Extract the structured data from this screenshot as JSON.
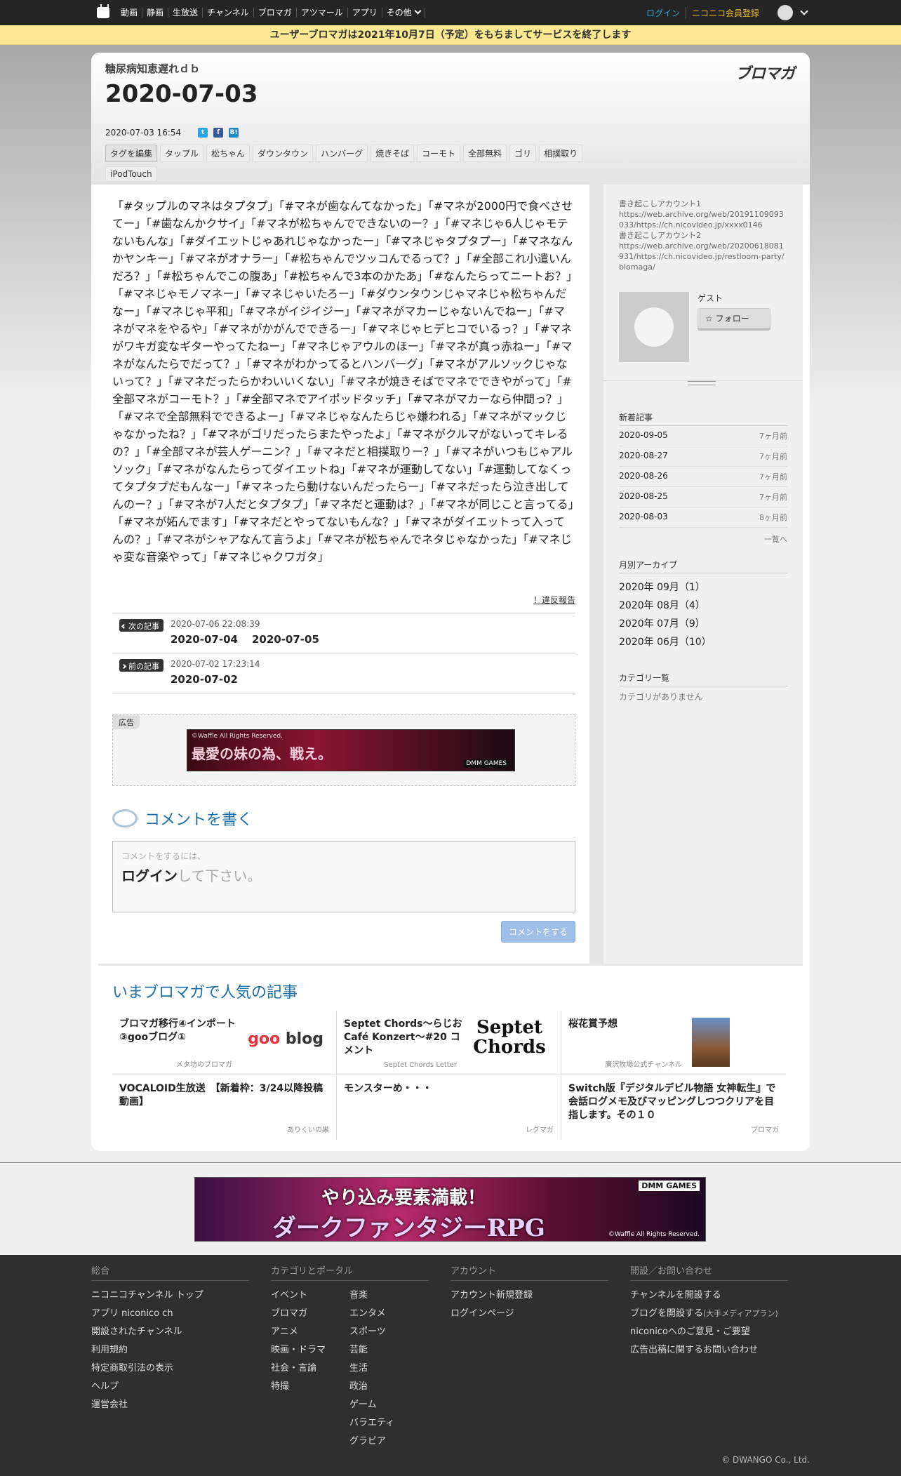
{
  "nav": {
    "items": [
      "動画",
      "静画",
      "生放送",
      "チャンネル",
      "ブロマガ",
      "アツマール",
      "アプリ",
      "その他"
    ],
    "login": "ログイン",
    "register": "ニコニコ会員登録"
  },
  "notice": "ユーザーブロマガは2021年10月7日（予定）をもちましてサービスを終了します",
  "header": {
    "channel": "糖尿病知恵遅れｄｂ",
    "title": "2020-07-03",
    "brand": "ブロマガ",
    "datetime": "2020-07-03 16:54",
    "tag_edit": "タグを編集",
    "tags": [
      "タップル",
      "松ちゃん",
      "ダウンタウン",
      "ハンバーグ",
      "焼きそば",
      "コーモト",
      "全部無料",
      "ゴリ",
      "相撲取り",
      "iPodTouch"
    ]
  },
  "article": {
    "body": "「#タップルのマネはタプタプ」「#マネが歯なんてなかった」「#マネが2000円で食べさせてー」「#歯なんかクサイ」「#マネが松ちゃんでできないのー？」「#マネじゃ6人じゃモテないもんな」「#ダイエットじゃあれじゃなかったー」「#マネじゃタプタプー」「#マネなんかヤンキー」「#マネがオナラー」「#松ちゃんでツッコんでるって？」「#全部これ小遣いんだろ？」「#松ちゃんでこの腹あ」「#松ちゃんで3本のかたあ」「#なんたらってニートお？」「#マネじゃモノマネー」「#マネじゃいたろー」「#ダウンタウンじゃマネじゃ松ちゃんだなー」「#マネじゃ平和」「#マネがイジイジー」「#マネがマカーじゃないんでねー」「#マネがマネをやるや」「#マネがかがんでできるー」「#マネじゃヒデヒコでいるっ？」「#マネがワキガ変なギターやってたねー」「#マネじゃアウルのほー」「#マネが真っ赤ねー」「#マネがなんたらでだって？」「#マネがわかってるとハンバーグ」「#マネがアルソックじゃないって？」「#マネだったらかわいいくない」「#マネが焼きそばでマネでできやがって」「#全部マネがコーモト？」「#全部マネでアイポッドタッチ」「#マネがマカーなら仲間っ？」「#マネで全部無料でできるよー」「#マネじゃなんたらじゃ嫌われる」「#マネがマックじゃなかったね？」「#マネがゴリだったらまたやったよ」「#マネがクルマがないってキレるの？」「#全部マネが芸人ゲーニン？」「#マネだと相撲取りー？」「#マネがいつもじゃアルソック」「#マネがなんたらってダイエットね」「#マネが運動してない」「#運動してなくってタプタプだもんなー」「#マネったら動けないんだったらー」「#マネだったら泣き出してんのー？」「#マネが7人だとタプタプ」「#マネだと運動は？」「#マネが同じこと言ってる」「#マネが妬んでます」「#マネだとやってないもんな？」「#マネがダイエットって入ってんの？」「#マネがシャアなんて言うよ」「#マネが松ちゃんでネタじゃなかった」「#マネじゃ変な音楽やって」「#マネじゃクワガタ」",
    "report": "！違反報告",
    "next_label": "次の記事",
    "next_date": "2020-07-06 22:08:39",
    "next_titles": [
      "2020-07-04",
      "2020-07-05"
    ],
    "prev_label": "前の記事",
    "prev_date": "2020-07-02 17:23:14",
    "prev_title": "2020-07-02"
  },
  "ad": {
    "label": "広告",
    "copy": "©Waffle All Rights Reserved.",
    "text": "最愛の妹の為、戦え。",
    "maker": "DMM GAMES"
  },
  "comment": {
    "heading": "コメントを書く",
    "hint": "コメントをするには、",
    "login": "ログイン",
    "login_suffix": "して下さい。",
    "button": "コメントをする"
  },
  "sidebar": {
    "links": [
      "書き起こしアカウント1",
      "https://web.archive.org/web/20191109093033/https://ch.nicovideo.jp/xxxx0146",
      "書き起こしアカウント2",
      "https://web.archive.org/web/20200618081931/https://ch.nicovideo.jp/restloom-party/blomaga/"
    ],
    "guest": "ゲスト",
    "follow": "フォロー",
    "recent_title": "新着記事",
    "recent": [
      {
        "date": "2020-09-05",
        "ago": "7ヶ月前"
      },
      {
        "date": "2020-08-27",
        "ago": "7ヶ月前"
      },
      {
        "date": "2020-08-26",
        "ago": "7ヶ月前"
      },
      {
        "date": "2020-08-25",
        "ago": "7ヶ月前"
      },
      {
        "date": "2020-08-03",
        "ago": "8ヶ月前"
      }
    ],
    "list_link": "一覧へ",
    "archive_title": "月別アーカイブ",
    "archive": [
      "2020年 09月（1）",
      "2020年 08月（4）",
      "2020年 07月（9）",
      "2020年 06月（10）"
    ],
    "category_title": "カテゴリ一覧",
    "category_none": "カテゴリがありません"
  },
  "popular": {
    "title": "いまブロマガで人気の記事",
    "items": [
      {
        "title": "ブロマガ移行④インポート③gooブログ①",
        "source": "メタ坊のブロマガ"
      },
      {
        "title": "Septet Chords〜らじおCafé Konzert〜#20 コメント",
        "source": "Septet Chords Letter"
      },
      {
        "title": "桜花賞予想",
        "source": "廣沢牧場公式チャンネル"
      },
      {
        "title": "VOCALOID生放送　【新着枠：3/24以降投稿動画】",
        "source": "ありくいの巣"
      },
      {
        "title": "モンスターめ・・・",
        "source": "レグマガ"
      },
      {
        "title": "Switch版『デジタルデビル物語 女神転生』で会話ログメモ及びマッピングしつつクリアを目指します。その１０",
        "source": "ブロマガ"
      }
    ],
    "goo_g": "goo",
    "goo_b": " blog",
    "septet_1": "Septet",
    "septet_2": "Chords"
  },
  "banner": {
    "line1": "やり込み要素満載！",
    "line2": "ダークファンタジーRPG",
    "maker": "DMM GAMES",
    "copy": "©Waffle All Rights Reserved."
  },
  "footer": {
    "col1_title": "総合",
    "col1": [
      "ニコニコチャンネル トップ",
      "アプリ niconico ch",
      "開設されたチャンネル",
      "利用規約",
      "特定商取引法の表示",
      "ヘルプ",
      "運営会社"
    ],
    "col2_title": "カテゴリとポータル",
    "col2a": [
      "イベント",
      "ブロマガ",
      "アニメ",
      "映画・ドラマ",
      "社会・言論",
      "特撮"
    ],
    "col2b": [
      "音楽",
      "エンタメ",
      "スポーツ",
      "芸能",
      "生活",
      "政治",
      "ゲーム",
      "バラエティ",
      "グラビア"
    ],
    "col3_title": "アカウント",
    "col3": [
      "アカウント新規登録",
      "ログインページ"
    ],
    "col4_title": "開設／お問い合わせ",
    "col4": [
      "チャンネルを開設する",
      "ブログを開設する",
      "niconicoへのご意見・ご要望",
      "広告出稿に関するお問い合わせ"
    ],
    "col4_note": "(大手メディアプラン)",
    "copyright": "© DWANGO Co., Ltd."
  }
}
